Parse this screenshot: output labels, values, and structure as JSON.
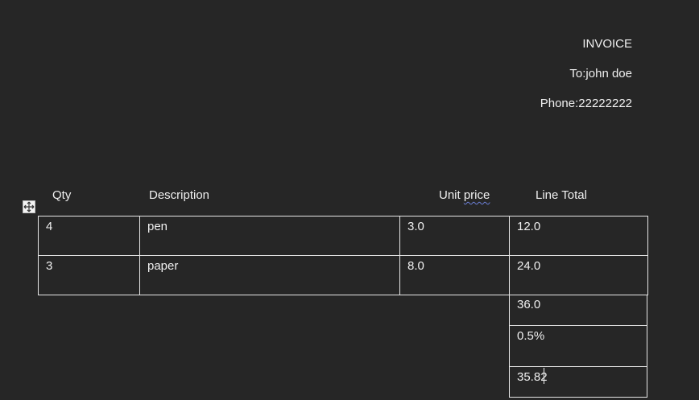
{
  "header": {
    "title": "INVOICE",
    "to_line": "To:john doe",
    "phone_line": "Phone:22222222"
  },
  "table": {
    "columns": [
      "Qty",
      "Description",
      "Unit price",
      "Line Total"
    ],
    "rows": [
      {
        "qty": "4",
        "description": "pen",
        "unit_price": "3.0",
        "line_total": "12.0"
      },
      {
        "qty": "3",
        "description": "paper",
        "unit_price": "8.0",
        "line_total": "24.0"
      }
    ]
  },
  "totals": {
    "subtotal": "36.0",
    "discount": "0.5%",
    "total": "35.82"
  },
  "icons": {
    "table_handle": "move-icon"
  }
}
